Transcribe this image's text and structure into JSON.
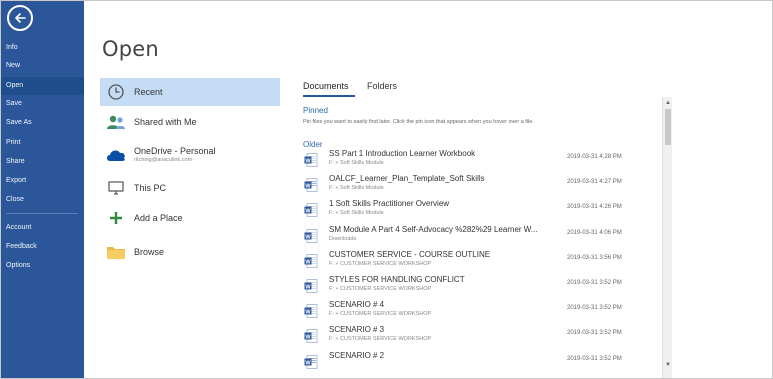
{
  "nav": {
    "items": [
      {
        "label": "Info"
      },
      {
        "label": "New"
      },
      {
        "label": "Open"
      },
      {
        "label": "Save"
      },
      {
        "label": "Save As"
      },
      {
        "label": "Print"
      },
      {
        "label": "Share"
      },
      {
        "label": "Export"
      },
      {
        "label": "Close"
      },
      {
        "label": "Account"
      },
      {
        "label": "Feedback"
      },
      {
        "label": "Options"
      }
    ],
    "active": "Open"
  },
  "page": {
    "title": "Open"
  },
  "places": {
    "items": [
      {
        "label": "Recent",
        "icon": "clock-icon"
      },
      {
        "label": "Shared with Me",
        "icon": "people-icon"
      },
      {
        "label": "OneDrive - Personal",
        "sublabel": "ritching@avaculink.com",
        "icon": "cloud-icon"
      },
      {
        "label": "This PC",
        "icon": "monitor-icon"
      },
      {
        "label": "Add a Place",
        "icon": "plus-icon"
      },
      {
        "label": "Browse",
        "icon": "folder-icon"
      }
    ]
  },
  "tabs": [
    {
      "label": "Documents"
    },
    {
      "label": "Folders"
    }
  ],
  "pinned": {
    "heading": "Pinned",
    "hint": "Pin files you want to easily find later. Click the pin icon that appears when you hover over a file."
  },
  "older": {
    "heading": "Older"
  },
  "files": [
    {
      "name": "SS Part 1 Introduction Learner Workbook",
      "path": "F: » Soft Skills Module",
      "date": "2019-03-31 4:28 PM",
      "icon": "word-doc-icon"
    },
    {
      "name": "OALCF_Learner_Plan_Template_Soft Skills",
      "path": "F: » Soft Skills Module",
      "date": "2019-03-31 4:27 PM",
      "icon": "word-template-icon"
    },
    {
      "name": "1 Soft Skills Practitioner Overview",
      "path": "F: » Soft Skills Module",
      "date": "2019-03-31 4:26 PM",
      "icon": "word-doc-icon"
    },
    {
      "name": "SM Module A Part 4 Self-Advocacy %282%29 Learner W...",
      "path": "Downloads",
      "date": "2019-03-31 4:06 PM",
      "icon": "word-doc-icon"
    },
    {
      "name": "CUSTOMER SERVICE - COURSE OUTLINE",
      "path": "F: » CUSTOMER SERVICE WORKSHOP",
      "date": "2019-03-31 3:56 PM",
      "icon": "word-doc-icon"
    },
    {
      "name": "STYLES FOR HANDLING CONFLICT",
      "path": "F: » CUSTOMER SERVICE WORKSHOP",
      "date": "2019-03-31 3:52 PM",
      "icon": "word-doc-icon"
    },
    {
      "name": "SCENARIO # 4",
      "path": "F: » CUSTOMER SERVICE WORKSHOP",
      "date": "2019-03-31 3:52 PM",
      "icon": "word-doc-icon"
    },
    {
      "name": "SCENARIO # 3",
      "path": "F: » CUSTOMER SERVICE WORKSHOP",
      "date": "2019-03-31 3:52 PM",
      "icon": "word-doc-icon"
    },
    {
      "name": "SCENARIO # 2",
      "path": "",
      "date": "2019-03-31 3:52 PM",
      "icon": "word-template-icon"
    }
  ],
  "colors": {
    "rail": "#2b579a",
    "rail_active": "#1e4e8c",
    "selected_place": "#c5dcf5",
    "accent": "#2b579a"
  }
}
